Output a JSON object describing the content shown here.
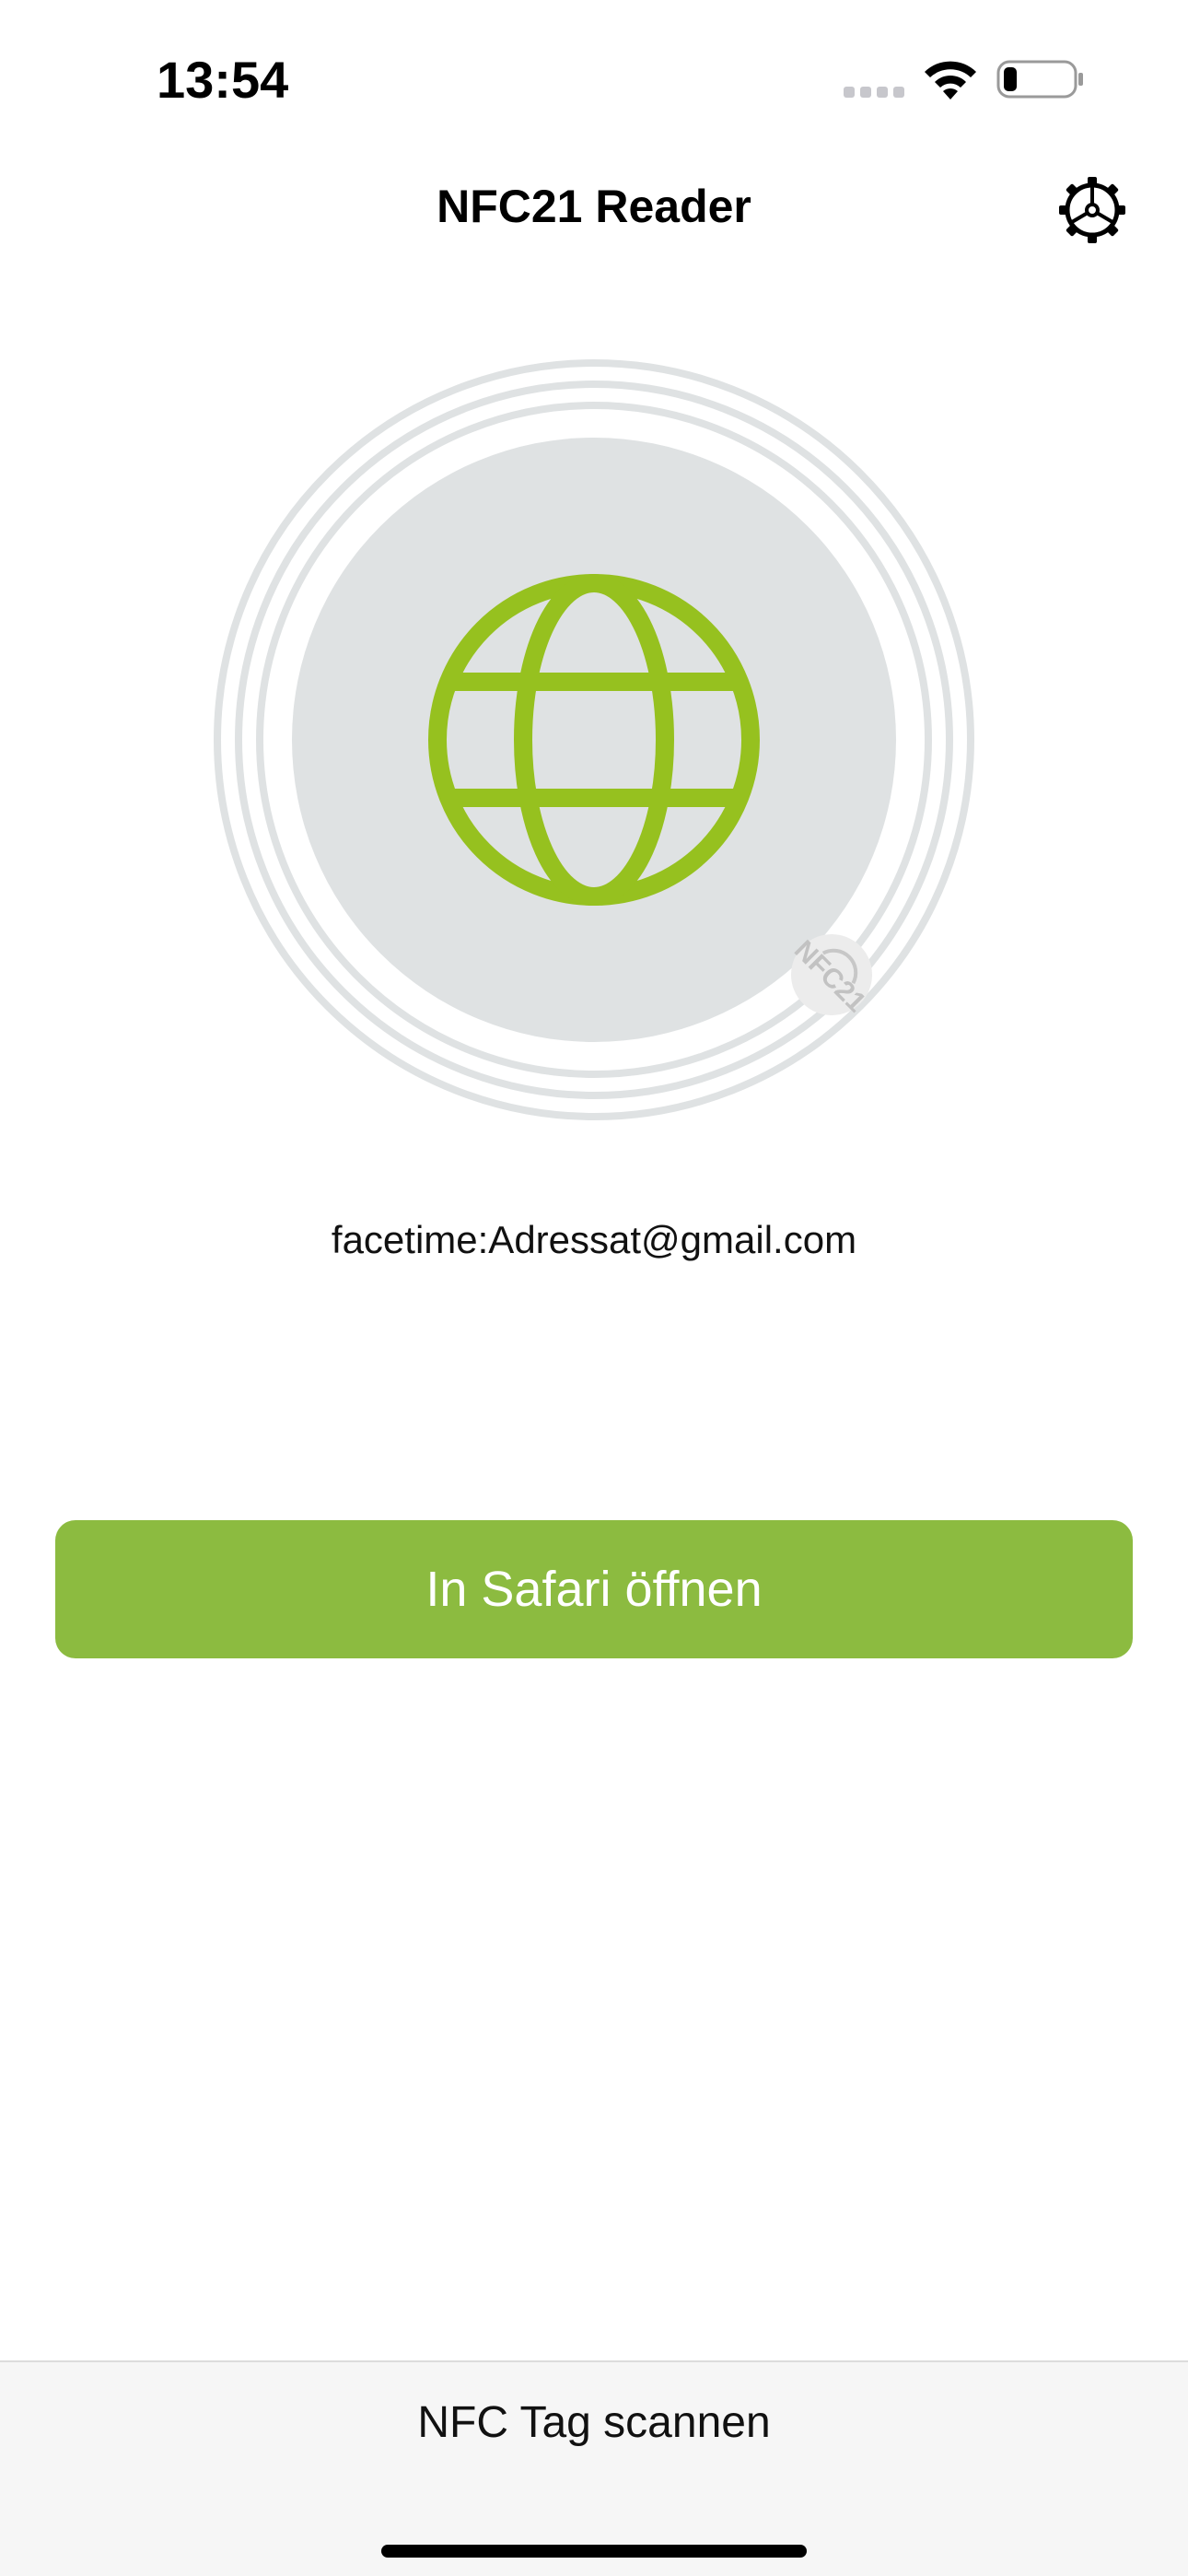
{
  "status_bar": {
    "time": "13:54"
  },
  "nav": {
    "title": "NFC21 Reader",
    "settings_icon": "gear-icon"
  },
  "tag": {
    "icon": "globe-icon",
    "badge_logo": "NFC21",
    "content": "facetime:Adressat@gmail.com"
  },
  "actions": {
    "open_label": "In Safari öffnen",
    "scan_label": "NFC Tag scannen"
  },
  "colors": {
    "accent": "#8cbb40",
    "globe": "#96c11f",
    "disc": "#dfe2e3",
    "bottom_bar": "#f6f6f6"
  }
}
